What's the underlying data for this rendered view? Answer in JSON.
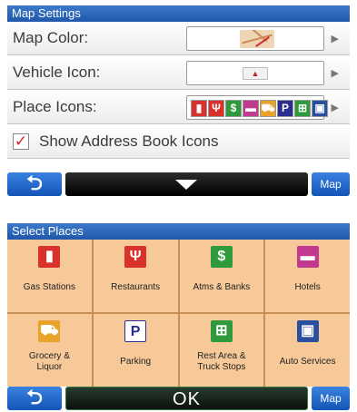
{
  "colors": {
    "title_bar": "#2a64b8",
    "accent_red": "#cc2222",
    "cell_bg": "#f7c998",
    "nav_blue": "#1e66cc"
  },
  "map_settings": {
    "title": "Map Settings",
    "rows": [
      {
        "label": "Map Color:"
      },
      {
        "label": "Vehicle Icon:"
      },
      {
        "label": "Place Icons:"
      }
    ],
    "checkbox": {
      "label": "Show Address Book Icons",
      "checked": true
    },
    "nav": {
      "back_icon": "back-arrow-icon",
      "center_icon": "down-arrow-icon",
      "map_label": "Map"
    },
    "place_icon_strip": [
      "gas-icon",
      "restaurant-icon",
      "dollar-icon",
      "hotel-icon",
      "grocery-icon",
      "parking-icon",
      "rest-area-icon",
      "auto-service-icon"
    ]
  },
  "select_places": {
    "title": "Select Places",
    "cells": [
      {
        "label": "Gas Stations",
        "icon": "gas-pump-icon",
        "icon_glyph": "▮",
        "icon_color": "#d9312b"
      },
      {
        "label": "Restaurants",
        "icon": "fork-knife-icon",
        "icon_glyph": "Ψ",
        "icon_color": "#d9312b"
      },
      {
        "label": "Atms & Banks",
        "icon": "dollar-icon",
        "icon_glyph": "$",
        "icon_color": "#2f9a3c"
      },
      {
        "label": "Hotels",
        "icon": "bed-icon",
        "icon_glyph": "▬",
        "icon_color": "#c23a8f"
      },
      {
        "label": "Grocery &\nLiquor",
        "icon": "shopping-cart-icon",
        "icon_glyph": "⛟",
        "icon_color": "#e9a22a"
      },
      {
        "label": "Parking",
        "icon": "parking-icon",
        "icon_glyph": "P",
        "icon_color": "#2a2f8f"
      },
      {
        "label": "Rest Area &\nTruck Stops",
        "icon": "rest-area-icon",
        "icon_glyph": "⊞",
        "icon_color": "#2f9a3c"
      },
      {
        "label": "Auto Services",
        "icon": "car-service-icon",
        "icon_glyph": "▣",
        "icon_color": "#2a4fa0"
      }
    ],
    "nav": {
      "back_icon": "back-arrow-icon",
      "ok_label": "OK",
      "map_label": "Map"
    }
  }
}
